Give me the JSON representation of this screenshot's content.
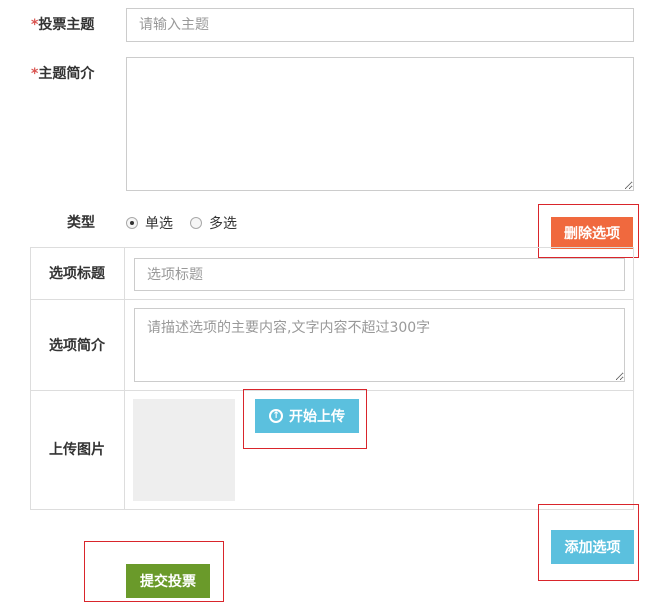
{
  "form": {
    "topic": {
      "required_mark": "*",
      "label": "投票主题",
      "placeholder": "请输入主题",
      "value": ""
    },
    "intro": {
      "required_mark": "*",
      "label": "主题简介",
      "value": ""
    },
    "type": {
      "label": "类型",
      "options": [
        {
          "label": "单选",
          "checked": true
        },
        {
          "label": "多选",
          "checked": false
        }
      ]
    },
    "delete_option_button": "删除选项",
    "option": {
      "title_label": "选项标题",
      "title_placeholder": "选项标题",
      "intro_label": "选项简介",
      "intro_placeholder": "请描述选项的主要内容,文字内容不超过300字",
      "image_label": "上传图片",
      "upload_button": "开始上传",
      "upload_icon": "upload-arrow-circle-icon"
    },
    "add_option_button": "添加选项",
    "submit_button": "提交投票"
  },
  "colors": {
    "danger": "#f0693e",
    "info": "#5bc0de",
    "success": "#6a9a2a",
    "required": "#d9534f",
    "highlight_frame": "#d9252b"
  }
}
